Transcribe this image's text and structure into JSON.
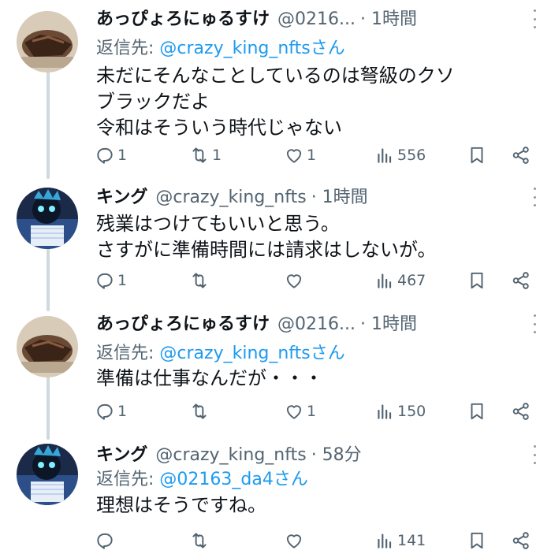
{
  "tweets": [
    {
      "name": "あっぴょろにゅるすけ",
      "handle": "@0216...",
      "time": "· 1時間",
      "reply_prefix": "返信先: ",
      "reply_mention": "@crazy_king_nftsさん",
      "lines": [
        "未だにそんなことしているのは弩級のクソ",
        "ブラックだよ",
        "令和はそういう時代じゃない"
      ],
      "stats": {
        "replies": "1",
        "retweets": "1",
        "likes": "1",
        "views": "556"
      }
    },
    {
      "name": "キング",
      "handle": "@crazy_king_nfts",
      "time": "· 1時間",
      "lines": [
        "残業はつけてもいいと思う。",
        "さすがに準備時間には請求はしないが。"
      ],
      "stats": {
        "replies": "1",
        "retweets": "",
        "likes": "",
        "views": "467"
      }
    },
    {
      "name": "あっぴょろにゅるすけ",
      "handle": "@0216...",
      "time": "· 1時間",
      "reply_prefix": "返信先: ",
      "reply_mention": "@crazy_king_nftsさん",
      "lines": [
        "準備は仕事なんだが・・・"
      ],
      "stats": {
        "replies": "1",
        "retweets": "",
        "likes": "1",
        "views": "150"
      }
    },
    {
      "name": "キング",
      "handle": "@crazy_king_nfts",
      "time": "· 58分",
      "reply_prefix": "返信先: ",
      "reply_mention": "@02163_da4さん",
      "lines": [
        "理想はそうですね。"
      ],
      "stats": {
        "replies": "",
        "retweets": "",
        "likes": "",
        "views": "141"
      }
    }
  ],
  "icons": {
    "reply": "reply-icon",
    "retweet": "retweet-icon",
    "like": "heart-icon",
    "views": "views-icon",
    "bookmark": "bookmark-icon",
    "share": "share-icon"
  },
  "colors": {
    "text": "#0f1419",
    "secondary": "#536471",
    "link": "#1d9bf0",
    "thread_line": "#cfd9de"
  }
}
